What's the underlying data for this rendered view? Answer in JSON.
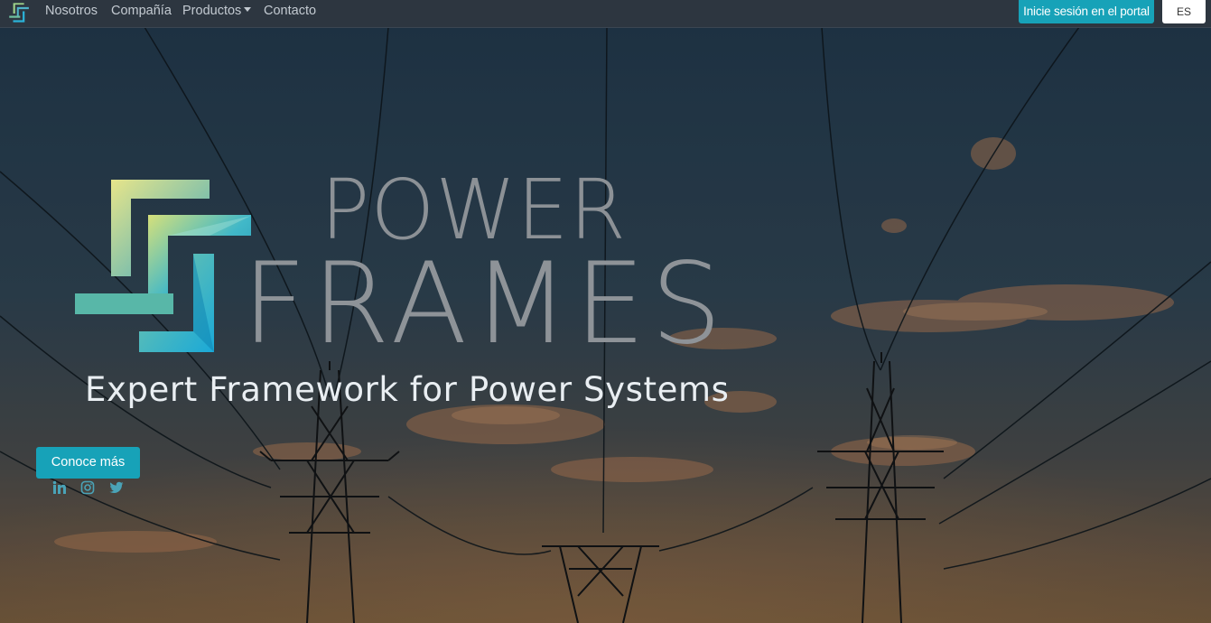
{
  "navbar": {
    "logo_icon": "power-frames-logo-icon",
    "links": [
      {
        "label": "Nosotros"
      },
      {
        "label": "Compañía"
      },
      {
        "label": "Productos",
        "has_dropdown": true
      },
      {
        "label": "Contacto"
      }
    ],
    "portal_button": "Inicie sesión en el portal",
    "language": "ES"
  },
  "hero": {
    "brand_line1": "POWER",
    "brand_line2": "FRAMES",
    "tagline": "Expert Framework for Power Systems",
    "cta_label": "Conoce más",
    "social_icons": [
      "linkedin-icon",
      "instagram-icon",
      "twitter-icon"
    ]
  },
  "colors": {
    "accent": "#17a2b8",
    "navbar_bg": "#2d3640",
    "sky_top": "#22384a",
    "sky_bottom": "#6e5438"
  }
}
